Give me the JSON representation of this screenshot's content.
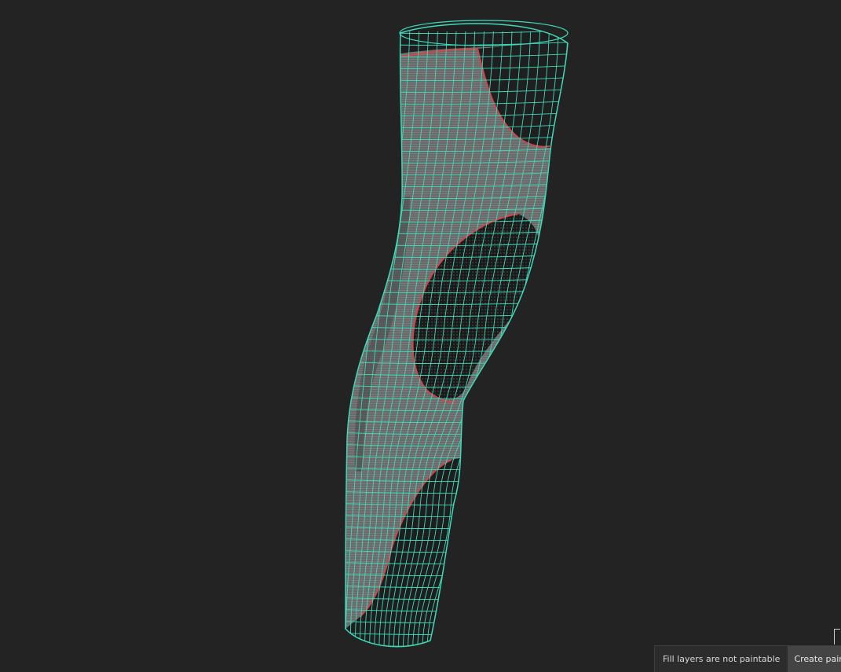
{
  "viewport": {
    "background": "#232323",
    "wireframe_color": "#3fd9b8",
    "seam_color": "#d2434a",
    "fabric_light": "#6d6d6d",
    "fabric_dark": "#1c1c1c"
  },
  "statusbar": {
    "message": "Fill layers are not paintable",
    "create_paint_layer_label": "Create paint lay"
  },
  "icons": {
    "corner": "resize-corner-icon"
  }
}
